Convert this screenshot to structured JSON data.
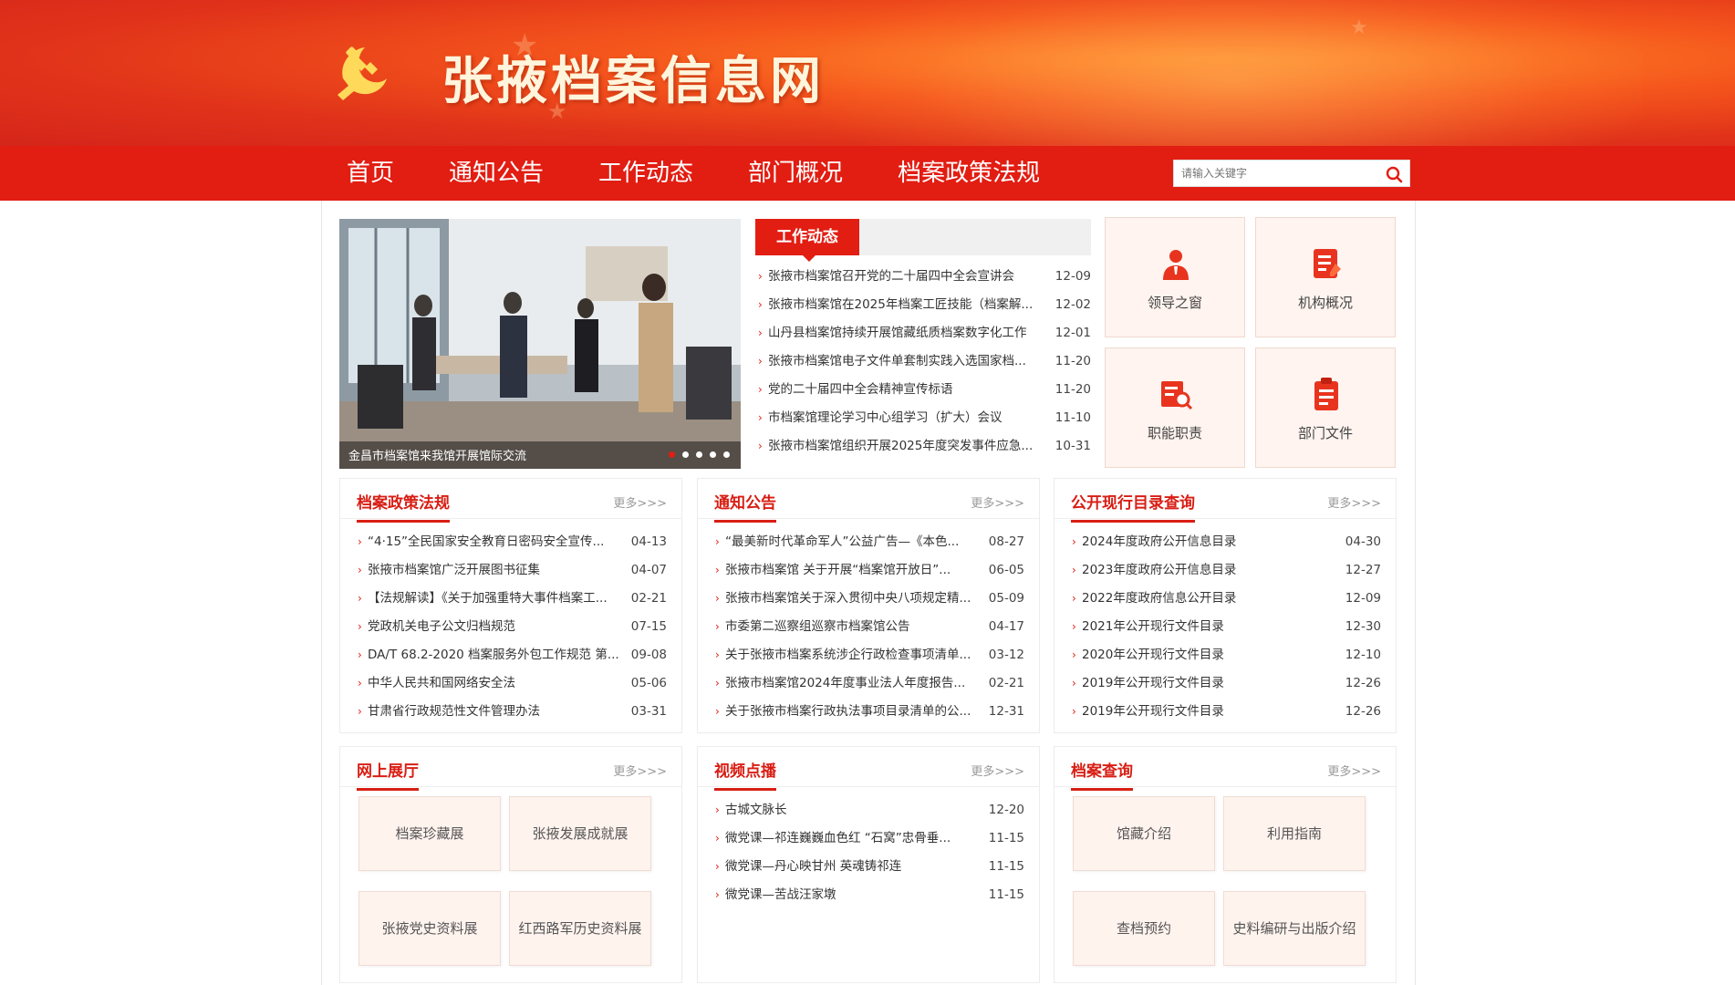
{
  "site": {
    "title": "张掖档案信息网"
  },
  "nav": {
    "items": [
      "首页",
      "通知公告",
      "工作动态",
      "部门概况",
      "档案政策法规"
    ],
    "search_placeholder": "请输入关键字"
  },
  "slideshow": {
    "caption": "金昌市档案馆来我馆开展馆际交流",
    "dots": 5,
    "active_dot": 0
  },
  "work": {
    "tab": "工作动态",
    "items": [
      {
        "title": "张掖市档案馆召开党的二十届四中全会宣讲会",
        "date": "12-09"
      },
      {
        "title": "张掖市档案馆在2025年档案工匠技能（档案解...",
        "date": "12-02"
      },
      {
        "title": "山丹县档案馆持续开展馆藏纸质档案数字化工作",
        "date": "12-01"
      },
      {
        "title": "张掖市档案馆电子文件单套制实践入选国家档...",
        "date": "11-20"
      },
      {
        "title": "党的二十届四中全会精神宣传标语",
        "date": "11-20"
      },
      {
        "title": "市档案馆理论学习中心组学习（扩大）会议",
        "date": "11-10"
      },
      {
        "title": "张掖市档案馆组织开展2025年度突发事件应急...",
        "date": "10-31"
      }
    ]
  },
  "tiles": [
    {
      "label": "领导之窗",
      "icon": "leader-icon"
    },
    {
      "label": "机构概况",
      "icon": "organization-icon"
    },
    {
      "label": "职能职责",
      "icon": "duty-search-icon"
    },
    {
      "label": "部门文件",
      "icon": "clipboard-icon"
    }
  ],
  "panels": {
    "policy": {
      "title": "档案政策法规",
      "more": "更多>>>",
      "items": [
        {
          "title": "“4·15”全民国家安全教育日密码安全宣传...",
          "date": "04-13"
        },
        {
          "title": "张掖市档案馆广泛开展图书征集",
          "date": "04-07"
        },
        {
          "title": "【法规解读】《关于加强重特大事件档案工...",
          "date": "02-21"
        },
        {
          "title": "党政机关电子公文归档规范",
          "date": "07-15"
        },
        {
          "title": "DA/T 68.2-2020 档案服务外包工作规范 第...",
          "date": "09-08"
        },
        {
          "title": "中华人民共和国网络安全法",
          "date": "05-06"
        },
        {
          "title": "甘肃省行政规范性文件管理办法",
          "date": "03-31"
        }
      ]
    },
    "notice": {
      "title": "通知公告",
      "more": "更多>>>",
      "items": [
        {
          "title": "“最美新时代革命军人”公益广告—《本色...",
          "date": "08-27"
        },
        {
          "title": "张掖市档案馆 关于开展“档案馆开放日”...",
          "date": "06-05"
        },
        {
          "title": "张掖市档案馆关于深入贯彻中央八项规定精...",
          "date": "05-09"
        },
        {
          "title": "市委第二巡察组巡察市档案馆公告",
          "date": "04-17"
        },
        {
          "title": "关于张掖市档案系统涉企行政检查事项清单...",
          "date": "03-12"
        },
        {
          "title": "张掖市档案馆2024年度事业法人年度报告...",
          "date": "02-21"
        },
        {
          "title": "关于张掖市档案行政执法事项目录清单的公...",
          "date": "12-31"
        }
      ]
    },
    "catalog": {
      "title": "公开现行目录查询",
      "more": "更多>>>",
      "items": [
        {
          "title": "2024年度政府公开信息目录",
          "date": "04-30"
        },
        {
          "title": "2023年度政府公开信息目录",
          "date": "12-27"
        },
        {
          "title": "2022年度政府信息公开目录",
          "date": "12-09"
        },
        {
          "title": "2021年公开现行文件目录",
          "date": "12-30"
        },
        {
          "title": "2020年公开现行文件目录",
          "date": "12-10"
        },
        {
          "title": "2019年公开现行文件目录",
          "date": "12-26"
        },
        {
          "title": "2019年公开现行文件目录",
          "date": "12-26"
        }
      ]
    },
    "exhibition": {
      "title": "网上展厅",
      "more": "更多>>>",
      "buttons": [
        "档案珍藏展",
        "张掖发展成就展",
        "张掖党史资料展",
        "红西路军历史资料展"
      ]
    },
    "video": {
      "title": "视频点播",
      "more": "更多>>>",
      "items": [
        {
          "title": "古城文脉长",
          "date": "12-20"
        },
        {
          "title": "微党课—祁连巍巍血色红 “石窝”忠骨垂...",
          "date": "11-15"
        },
        {
          "title": "微党课—丹心映甘州 英魂铸祁连",
          "date": "11-15"
        },
        {
          "title": "微党课—苦战汪家墩",
          "date": "11-15"
        }
      ]
    },
    "query": {
      "title": "档案查询",
      "more": "更多>>>",
      "buttons": [
        "馆藏介绍",
        "利用指南",
        "查档预约",
        "史料编研与出版介绍"
      ]
    }
  },
  "colors": {
    "primary_red": "#e21d12",
    "title_red": "#d81e14",
    "tile_bg": "#fff4ef"
  }
}
